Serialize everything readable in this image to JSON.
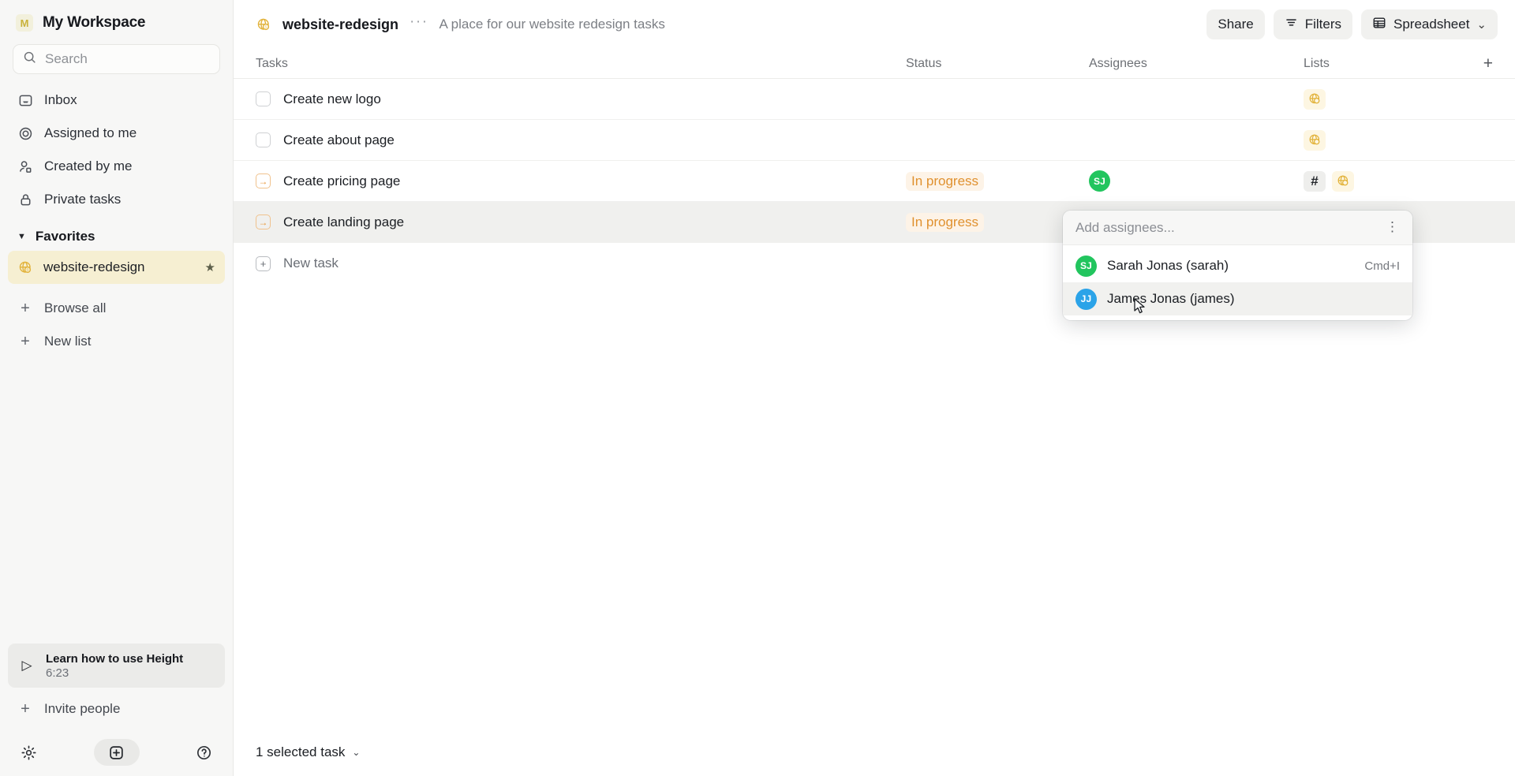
{
  "sidebar": {
    "workspace": {
      "initial": "M",
      "name": "My Workspace"
    },
    "search": {
      "placeholder": "Search",
      "icon": "search-icon"
    },
    "nav": [
      {
        "label": "Inbox",
        "icon": "inbox-icon"
      },
      {
        "label": "Assigned to me",
        "icon": "target-icon"
      },
      {
        "label": "Created by me",
        "icon": "user-icon"
      },
      {
        "label": "Private tasks",
        "icon": "lock-icon"
      }
    ],
    "favorites": {
      "label": "Favorites",
      "items": [
        {
          "label": "website-redesign",
          "icon": "globe-icon",
          "starred": true,
          "active": true
        }
      ]
    },
    "actions": [
      {
        "label": "Browse all",
        "icon": "plus-icon"
      },
      {
        "label": "New list",
        "icon": "plus-icon"
      }
    ],
    "learn_card": {
      "title": "Learn how to use Height",
      "duration": "6:23",
      "icon": "play-icon"
    },
    "invite": {
      "label": "Invite people",
      "icon": "plus-icon"
    },
    "bottom_icons": [
      {
        "name": "settings-gear-icon"
      },
      {
        "name": "new-item-icon"
      },
      {
        "name": "help-icon"
      }
    ]
  },
  "header": {
    "list_icon": "globe-icon",
    "title": "website-redesign",
    "more": "···",
    "description": "A place for our website redesign tasks",
    "buttons": [
      {
        "label": "Share",
        "icon": null
      },
      {
        "label": "Filters",
        "icon": "filter-icon"
      },
      {
        "label": "Spreadsheet",
        "icon": "grid-icon",
        "caret": "⌄"
      }
    ]
  },
  "table": {
    "columns": [
      "Tasks",
      "Status",
      "Assignees",
      "Lists"
    ],
    "add_column_icon": "plus-icon",
    "rows": [
      {
        "icon": "checkbox",
        "name": "Create new logo",
        "status": "",
        "assignees": [],
        "lists": [
          {
            "type": "globe"
          }
        ],
        "selected": false
      },
      {
        "icon": "checkbox",
        "name": "Create about page",
        "status": "",
        "assignees": [],
        "lists": [
          {
            "type": "globe"
          }
        ],
        "selected": false
      },
      {
        "icon": "arrow",
        "name": "Create pricing page",
        "status": "In progress",
        "assignees": [
          {
            "initials": "SJ",
            "color": "#22c55e"
          }
        ],
        "lists": [
          {
            "type": "hash",
            "label": "#"
          },
          {
            "type": "globe"
          }
        ],
        "selected": false
      },
      {
        "icon": "arrow",
        "name": "Create landing page",
        "status": "In progress",
        "assignees": [],
        "lists": [],
        "selected": true
      }
    ],
    "new_task": {
      "label": "New task",
      "icon": "plus-box-icon"
    }
  },
  "popup": {
    "placeholder": "Add assignees...",
    "kebab_icon": "kebab-menu-icon",
    "items": [
      {
        "initials": "SJ",
        "color": "#22c55e",
        "name": "Sarah Jonas (sarah)",
        "shortcut": "Cmd+I",
        "hovered": false
      },
      {
        "initials": "JJ",
        "color": "#2ba3e8",
        "name": "James Jonas (james)",
        "shortcut": "",
        "hovered": true
      }
    ]
  },
  "statusbar": {
    "selected_text": "1 selected task",
    "caret": "⌄"
  },
  "colors": {
    "accent_amber": "#e2b33c",
    "status_orange": "#e0912f",
    "favorite_bg": "#f6efd2",
    "sidebar_bg": "#f7f7f6",
    "selected_row": "#f0f0ee"
  }
}
